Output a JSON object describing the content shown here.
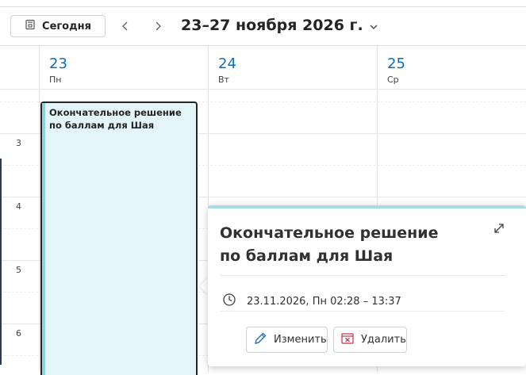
{
  "toolbar": {
    "today_label": "Сегодня",
    "date_range": "23–27 ноября 2026 г."
  },
  "days": [
    {
      "num": "23",
      "name": "Пн"
    },
    {
      "num": "24",
      "name": "Вт"
    },
    {
      "num": "25",
      "name": "Ср"
    }
  ],
  "hours": [
    "3",
    "4",
    "5",
    "6"
  ],
  "event": {
    "title": "Окончательное решение по баллам для Шая",
    "color": "#e3f5f9"
  },
  "popup": {
    "title": "Окончательное решение по баллам для Шая",
    "time": "23.11.2026, Пн 02:28 – 13:37",
    "edit_label": "Изменить",
    "delete_label": "Удалить"
  },
  "colors": {
    "accent": "#0f6cbd",
    "event_bar": "#8fd3df",
    "delete_icon": "#c4314b"
  }
}
